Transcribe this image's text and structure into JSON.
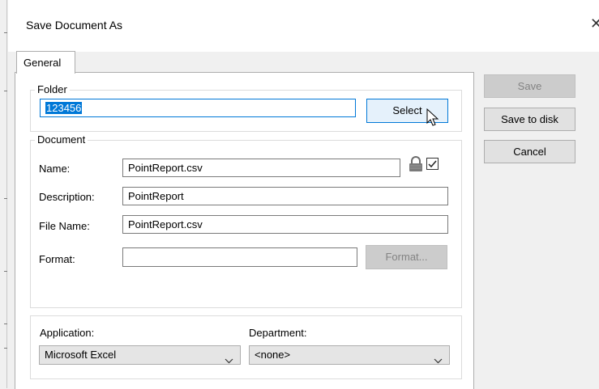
{
  "dialog": {
    "title": "Save Document As",
    "close_glyph": "✕"
  },
  "tabs": [
    {
      "label": "General",
      "active": true
    }
  ],
  "folder": {
    "legend": "Folder",
    "value": "123456",
    "select_label": "Select"
  },
  "document": {
    "legend": "Document",
    "name_label": "Name:",
    "name_value": "PointReport.csv",
    "lock_icon": "lock-icon",
    "locked_checked": true,
    "description_label": "Description:",
    "description_value": "PointReport",
    "filename_label": "File Name:",
    "filename_value": "PointReport.csv",
    "format_label": "Format:",
    "format_value": "",
    "format_button": "Format..."
  },
  "classification": {
    "application_label": "Application:",
    "application_value": "Microsoft Excel",
    "department_label": "Department:",
    "department_value": "<none>"
  },
  "actions": {
    "save": "Save",
    "save_to_disk": "Save to disk",
    "cancel": "Cancel"
  }
}
